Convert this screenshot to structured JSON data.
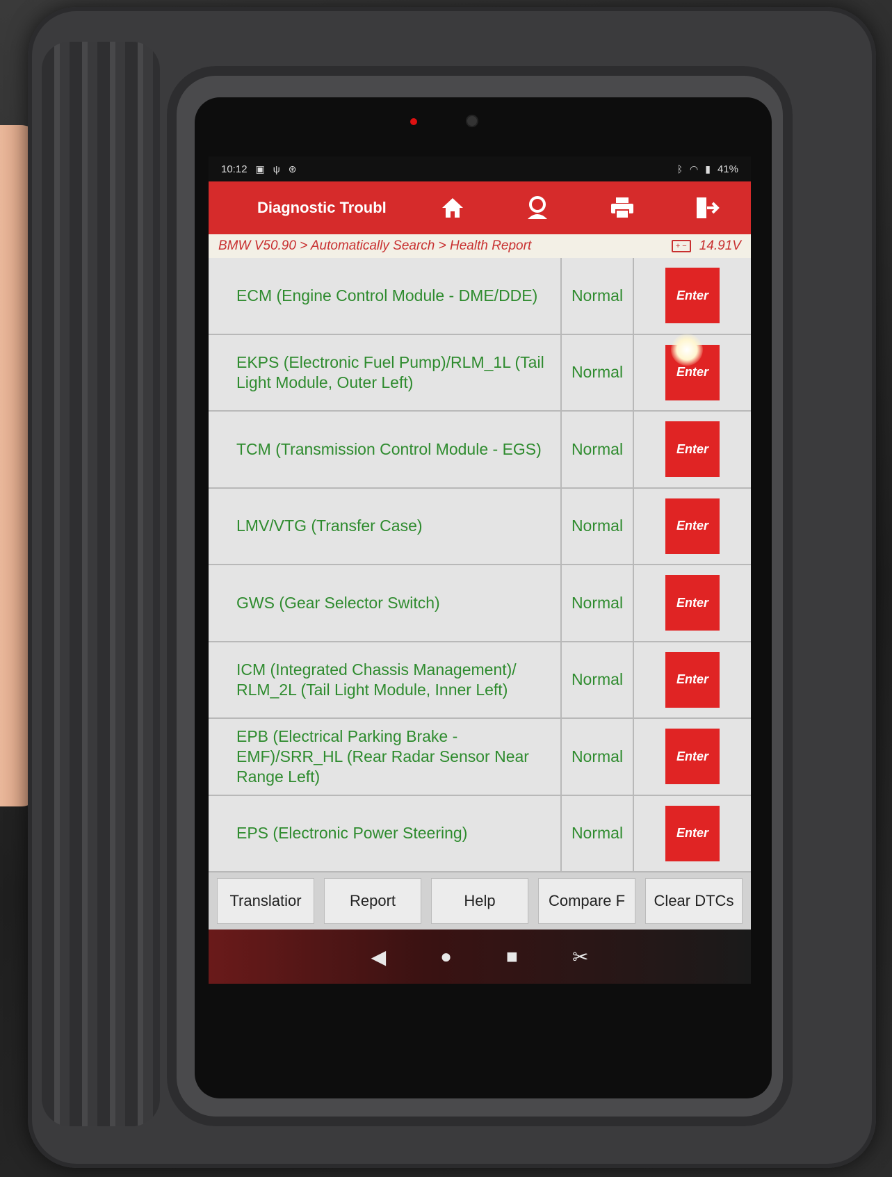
{
  "statusbar": {
    "time": "10:12",
    "battery": "41%"
  },
  "titlebar": {
    "title": "Diagnostic Troubl",
    "icons": [
      "home-icon",
      "user-icon",
      "print-icon",
      "exit-icon"
    ]
  },
  "breadcrumb": {
    "path": "BMW V50.90 > Automatically Search > Health Report",
    "voltage": "14.91V"
  },
  "modules": [
    {
      "name": "ECM (Engine Control Module - DME/DDE)",
      "status": "Normal",
      "action": "Enter"
    },
    {
      "name": "EKPS (Electronic Fuel Pump)/RLM_1L (Tail Light Module, Outer Left)",
      "status": "Normal",
      "action": "Enter"
    },
    {
      "name": "TCM (Transmission Control Module - EGS)",
      "status": "Normal",
      "action": "Enter"
    },
    {
      "name": "LMV/VTG (Transfer Case)",
      "status": "Normal",
      "action": "Enter"
    },
    {
      "name": "GWS (Gear Selector Switch)",
      "status": "Normal",
      "action": "Enter"
    },
    {
      "name": "ICM (Integrated Chassis Management)/ RLM_2L (Tail Light Module, Inner Left)",
      "status": "Normal",
      "action": "Enter"
    },
    {
      "name": "EPB (Electrical Parking Brake - EMF)/SRR_HL (Rear Radar Sensor Near Range Left)",
      "status": "Normal",
      "action": "Enter"
    },
    {
      "name": "EPS (Electronic Power Steering)",
      "status": "Normal",
      "action": "Enter"
    }
  ],
  "bottom_buttons": {
    "translation": "Translatior",
    "report": "Report",
    "help": "Help",
    "compare": "Compare F",
    "clear": "Clear DTCs"
  },
  "colors": {
    "accent": "#d62b2b",
    "status_text": "#2e8b2e",
    "enter_button": "#e02424"
  }
}
